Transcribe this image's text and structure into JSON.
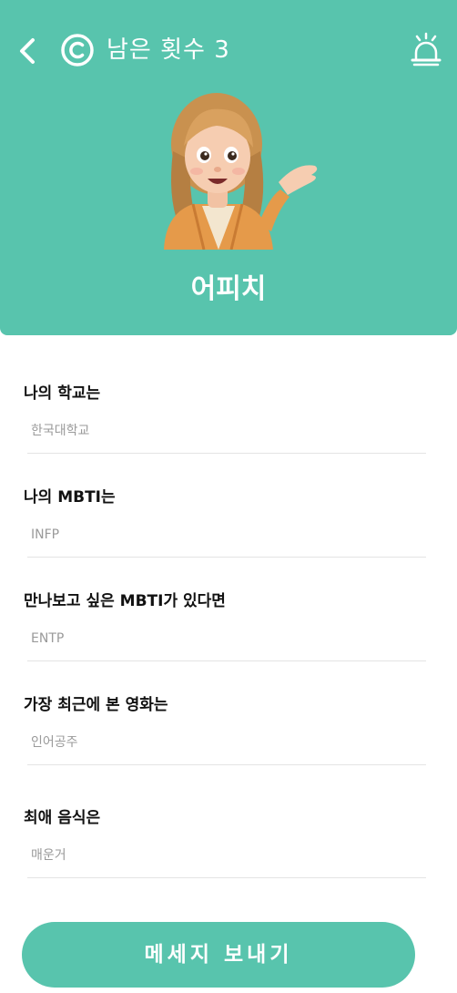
{
  "header": {
    "remaining_label": "남은 횟수 3",
    "profile_name": "어피치",
    "icons": {
      "back": "chevron-left-icon",
      "coin": "coin-c-icon",
      "notification": "bell-icon"
    }
  },
  "form": {
    "fields": [
      {
        "label": "나의 학교는",
        "value": "한국대학교"
      },
      {
        "label": "나의 MBTI는",
        "value": "INFP"
      },
      {
        "label": "만나보고 싶은 MBTI가 있다면",
        "value": "ENTP"
      },
      {
        "label": "가장 최근에 본 영화는",
        "value": "인어공주"
      },
      {
        "label": "최애 음식은",
        "value": "매운거"
      }
    ]
  },
  "actions": {
    "send_label": "메세지 보내기"
  },
  "colors": {
    "brand": "#58c4ad",
    "background": "#ffffff",
    "value_text": "#9a9a9a"
  }
}
